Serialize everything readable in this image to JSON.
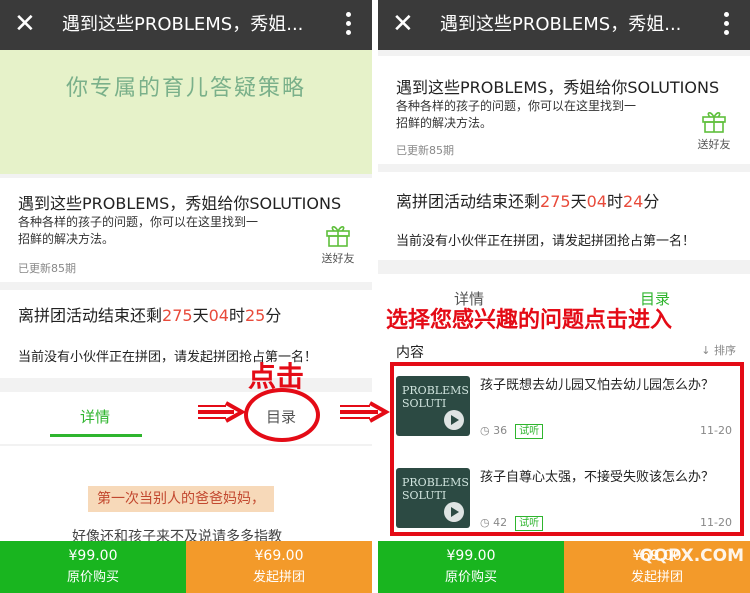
{
  "header": {
    "close_symbol": "✕",
    "title": "遇到这些PROBLEMS，秀姐..."
  },
  "banner": {
    "text": "你专属的育儿答疑策略"
  },
  "course": {
    "title": "遇到这些PROBLEMS，秀姐给你SOLUTIONS",
    "desc": "各种各样的孩子的问题，你可以在这里找到一招鲜的解决方法。",
    "updated": "已更新85期",
    "gift_label": "送好友"
  },
  "group": {
    "prefix": "离拼团活动结束还剩",
    "left": {
      "days": "275",
      "hours": "04",
      "minutes": "25"
    },
    "right": {
      "days": "275",
      "hours": "04",
      "minutes": "24"
    },
    "unit_day": "天",
    "unit_hour": "时",
    "unit_minute": "分",
    "notice": "当前没有小伙伴正在拼团，请发起拼团抢占第一名！"
  },
  "tabs": {
    "details": "详情",
    "catalog": "目录"
  },
  "content": {
    "heading": "内容",
    "sort": "↓ 排序",
    "highlight": "第一次当别人的爸爸妈妈，",
    "sub": "好像还和孩子来不及说请多多指教"
  },
  "lessons": [
    {
      "title": "孩子既想去幼儿园又怕去幼儿园怎么办？",
      "views": "36",
      "tag": "试听",
      "date": "11-20",
      "thumb_text": "PROBLEMS SOLUTI"
    },
    {
      "title": "孩子自尊心太强，不接受失败该怎么办？",
      "views": "42",
      "tag": "试听",
      "date": "11-20",
      "thumb_text": "PROBLEMS SOLUTI"
    }
  ],
  "bottom": {
    "buy_price": "¥99.00",
    "buy_label": "原价购买",
    "group_price": "¥69.00",
    "group_label": "发起拼团"
  },
  "annotations": {
    "click": "点击",
    "choose": "选择您感兴趣的问题点击进入"
  },
  "watermark": "QQPX.COM",
  "colors": {
    "accent_green": "#2fb52e",
    "buy_green": "#19b51f",
    "group_orange": "#f39a2a",
    "countdown_red": "#e84a3a",
    "annotation_red": "#e40b16",
    "topbar": "#3a3a3a",
    "banner": "#e6f2c9"
  }
}
